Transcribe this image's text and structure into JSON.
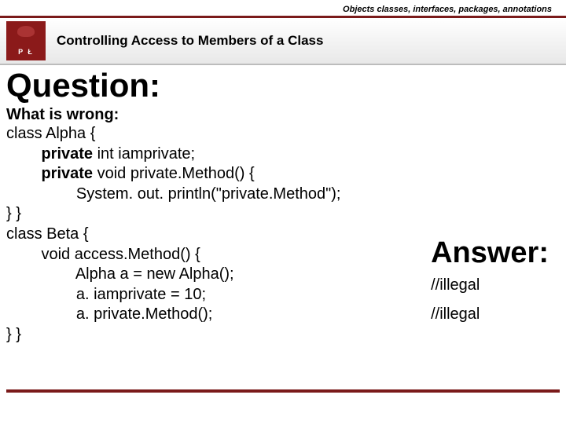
{
  "header": {
    "topic": "Objects classes, interfaces, packages, annotations",
    "title": "Controlling Access to Members of a Class",
    "logo_text": "P Ł"
  },
  "question": {
    "heading": "Question:",
    "prompt": "What is wrong:"
  },
  "code": {
    "l1a": "class Alpha {",
    "l2k": "private",
    "l2r": " int iamprivate;",
    "l3k": "private",
    "l3r": " void private.Method() {",
    "l4": "System. out. println(\"private.Method\");",
    "l5": "} }",
    "l6": "class Beta {",
    "l7": "void access.Method() {",
    "l8": "Alpha a = new Alpha();",
    "l9": "a. iamprivate = 10;",
    "l10": "a. private.Method();",
    "l11": "} }"
  },
  "answer": {
    "heading": "Answer:",
    "note1": "//illegal",
    "note2": "//illegal"
  }
}
